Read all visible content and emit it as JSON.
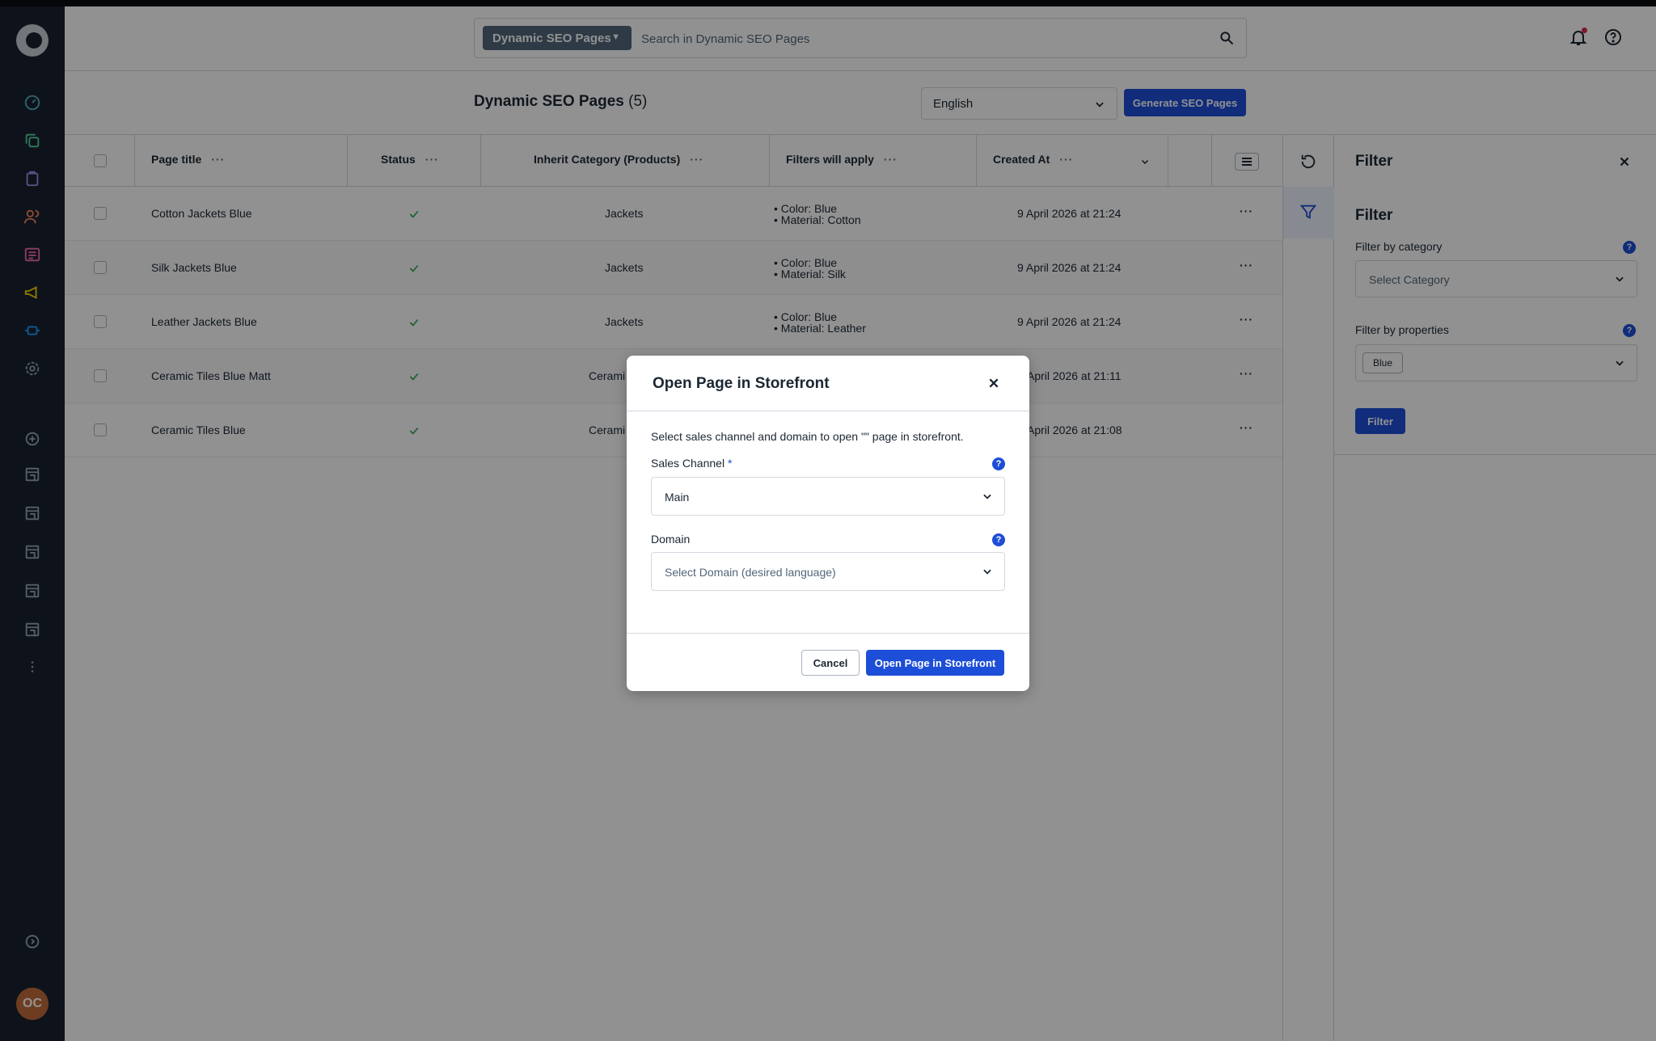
{
  "header": {
    "search_module": "Dynamic SEO Pages",
    "search_placeholder": "Search in Dynamic SEO Pages"
  },
  "smartbar": {
    "title": "Dynamic SEO Pages",
    "count": "(5)",
    "language": "English",
    "generate_button": "Generate SEO Pages"
  },
  "table": {
    "columns": [
      "Page title",
      "Status",
      "Inherit Category (Products)",
      "Filters will apply",
      "Created At"
    ],
    "rows": [
      {
        "title": "Cotton Jackets Blue",
        "status": "active",
        "category": "Jackets",
        "filters": [
          "Color: Blue",
          "Material: Cotton"
        ],
        "created": "9 April 2026 at 21:24"
      },
      {
        "title": "Silk Jackets Blue",
        "status": "active",
        "category": "Jackets",
        "filters": [
          "Color: Blue",
          "Material: Silk"
        ],
        "created": "9 April 2026 at 21:24"
      },
      {
        "title": "Leather Jackets Blue",
        "status": "active",
        "category": "Jackets",
        "filters": [
          "Color: Blue",
          "Material: Leather"
        ],
        "created": "9 April 2026 at 21:24"
      },
      {
        "title": "Ceramic Tiles Blue Matt",
        "status": "active",
        "category": "Cerami",
        "filters": [],
        "created": "April 2026 at 21:11"
      },
      {
        "title": "Ceramic Tiles Blue",
        "status": "active",
        "category": "Cerami",
        "filters": [],
        "created": "April 2026 at 21:08"
      }
    ]
  },
  "filter_panel": {
    "title": "Filter",
    "subtitle": "Filter",
    "category_label": "Filter by category",
    "category_placeholder": "Select Category",
    "properties_label": "Filter by properties",
    "properties_tag": "Blue",
    "filter_button": "Filter"
  },
  "modal": {
    "title": "Open Page in Storefront",
    "description": "Select sales channel and domain to open \"\" page in storefront.",
    "sales_channel_label": "Sales Channel",
    "required_mark": "*",
    "sales_channel_value": "Main",
    "domain_label": "Domain",
    "domain_placeholder": "Select Domain (desired language)",
    "cancel_button": "Cancel",
    "open_button": "Open Page in Storefront"
  },
  "user": {
    "initials": "OC"
  },
  "colors": {
    "sidebar_bg": "#1a2331",
    "primary": "#1d4ed8",
    "success": "#37a75b"
  }
}
